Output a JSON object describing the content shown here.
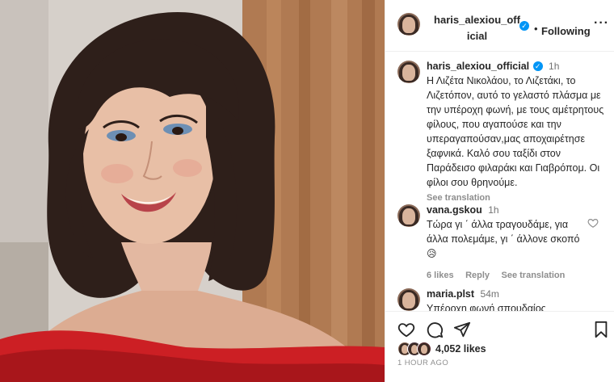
{
  "header": {
    "username": "haris_alexiou_official",
    "follow_label": "Following",
    "separator": "•",
    "more_label": "···"
  },
  "caption": {
    "username": "haris_alexiou_official",
    "time": "1h",
    "text": "Η Λιζέτα Νικολάου, το Λιζετάκι, το Λιζετόπον, αυτό το γελαστό πλάσμα με την υπέροχη φωνή, με τους αμέτρητους φίλους, που αγαπούσε και την υπεραγαπούσαν,μας αποχαιρέτησε ξαφνικά. Καλό σου ταξίδι στον Παράδεισο φιλαράκι και Γιαβρόπομ. Οι φίλοι σου θρηνούμε.",
    "see_translation": "See translation"
  },
  "comments": [
    {
      "username": "vana.gskou",
      "time": "1h",
      "text": "Τώρα γι ΄ άλλα τραγουδάμε, για άλλα πολεμάμε, γι ΄ άλλονε σκοπό",
      "emoji": "😥",
      "likes": "6 likes",
      "reply_label": "Reply",
      "see_translation": "See translation"
    },
    {
      "username": "maria.plst",
      "time": "54m",
      "text": "Υπέροχη φωνή σπουδαίος"
    }
  ],
  "actions": {
    "like_icon": "heart-icon",
    "comment_icon": "comment-icon",
    "share_icon": "send-icon",
    "save_icon": "bookmark-icon"
  },
  "likes": {
    "count": "4,052 likes"
  },
  "timestamp": "1 HOUR AGO",
  "colors": {
    "verified": "#0095f6",
    "text": "#262626",
    "secondary": "#737373",
    "dress": "#cc1f24",
    "curtain": "#a86e48"
  }
}
